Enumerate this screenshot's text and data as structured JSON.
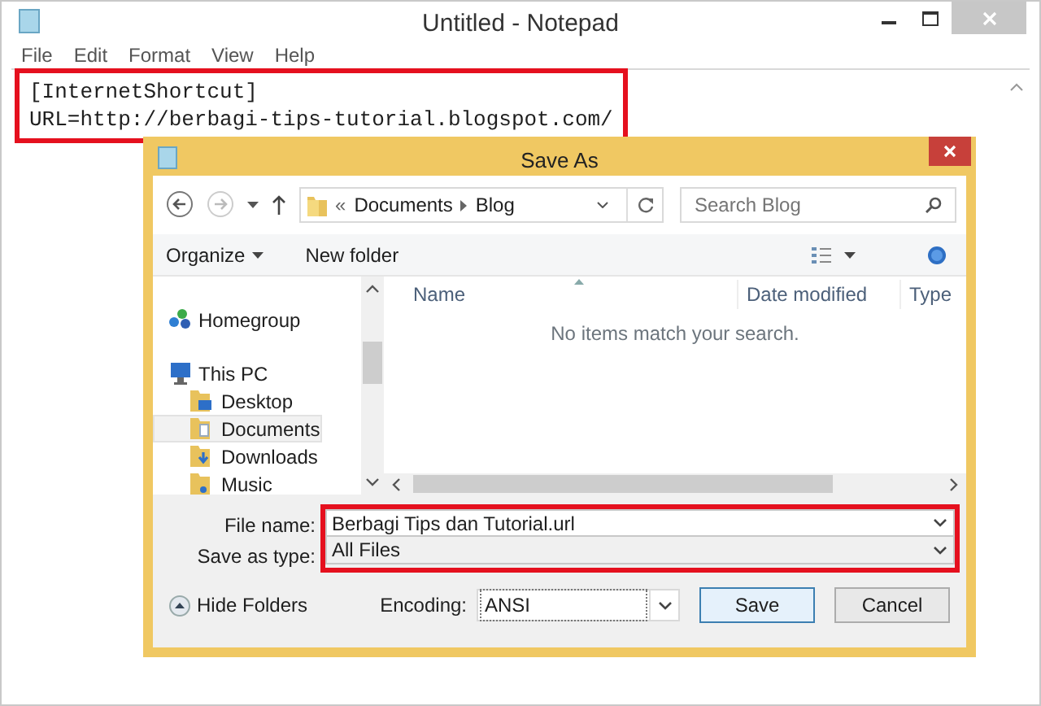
{
  "notepad": {
    "title": "Untitled - Notepad",
    "menu": [
      "File",
      "Edit",
      "Format",
      "View",
      "Help"
    ],
    "lines": [
      "[InternetShortcut]",
      "URL=http://berbagi-tips-tutorial.blogspot.com/"
    ]
  },
  "dialog": {
    "title": "Save As",
    "address": {
      "overflow": "«",
      "path": [
        "Documents",
        "Blog"
      ]
    },
    "search": {
      "placeholder": "Search Blog"
    },
    "toolbar": [
      {
        "label": "Organize",
        "kind": "menu"
      },
      {
        "label": "New folder",
        "kind": "plain"
      }
    ],
    "nav": [
      {
        "label": "Homegroup",
        "kind": "homegroup",
        "selected": false
      },
      {
        "label": "This PC",
        "kind": "pc",
        "selected": false,
        "children": [
          {
            "label": "Desktop",
            "kind": "desktop",
            "selected": false
          },
          {
            "label": "Documents",
            "kind": "documents",
            "selected": true
          },
          {
            "label": "Downloads",
            "kind": "downloads",
            "selected": false
          },
          {
            "label": "Music",
            "kind": "music",
            "selected": false
          }
        ]
      }
    ],
    "columns": [
      "Name",
      "Date modified",
      "Type"
    ],
    "empty_message": "No items match your search.",
    "fields": [
      {
        "label": "File name:",
        "value": "Berbagi Tips dan Tutorial.url",
        "kind": "editable"
      },
      {
        "label": "Save as type:",
        "value": "All Files",
        "kind": "list"
      }
    ],
    "hide_folders": "Hide Folders",
    "encoding": {
      "label": "Encoding:",
      "value": "ANSI"
    },
    "buttons": [
      {
        "label": "Save",
        "default": true
      },
      {
        "label": "Cancel",
        "default": false
      }
    ]
  }
}
